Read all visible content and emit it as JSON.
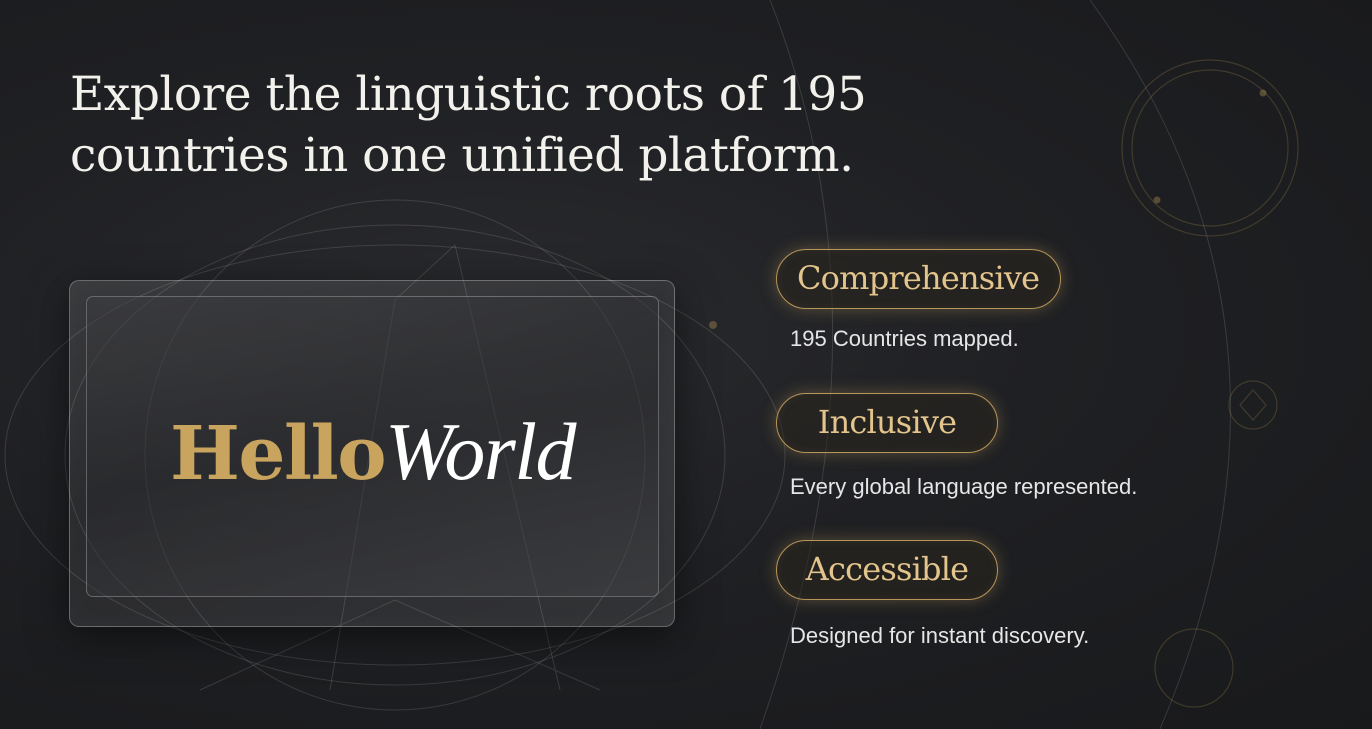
{
  "headline": {
    "line1": "Explore the linguistic roots of 195",
    "line2": "countries in one unified platform."
  },
  "brand": {
    "hello": "Hello",
    "world": "World"
  },
  "features": [
    {
      "label": "Comprehensive",
      "description": "195 Countries mapped."
    },
    {
      "label": "Inclusive",
      "description": "Every global language represented."
    },
    {
      "label": "Accessible",
      "description": "Designed for instant discovery."
    }
  ],
  "colors": {
    "background": "#1d1e21",
    "accent_gold": "#c9a45e",
    "text_light": "#f3f1ec"
  }
}
